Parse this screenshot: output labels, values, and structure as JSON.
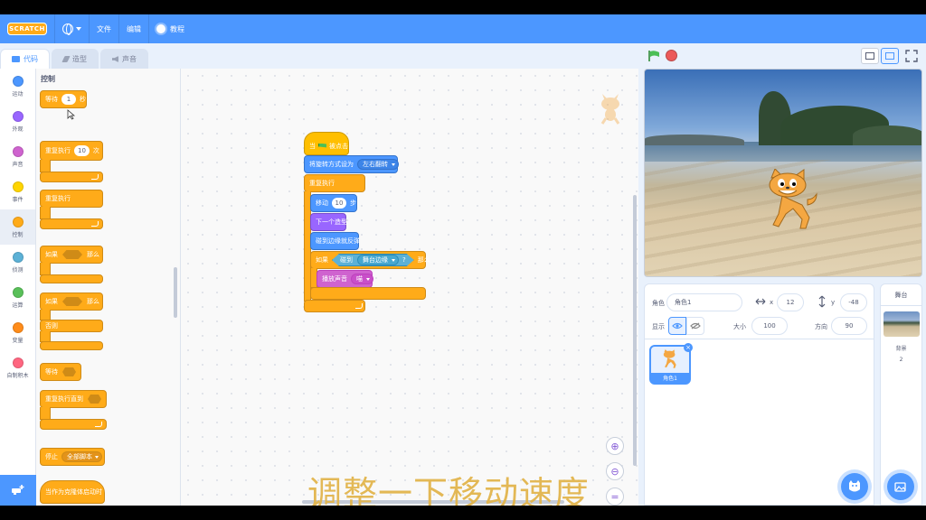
{
  "menu": {
    "logo": "SCRATCH",
    "file": "文件",
    "edit": "编辑",
    "tutorials": "教程"
  },
  "tabs": [
    {
      "label": "代码"
    },
    {
      "label": "造型"
    },
    {
      "label": "声音"
    }
  ],
  "categories": [
    {
      "label": "运动",
      "color": "#4c97ff"
    },
    {
      "label": "外观",
      "color": "#9966ff"
    },
    {
      "label": "声音",
      "color": "#cf63cf"
    },
    {
      "label": "事件",
      "color": "#ffd500"
    },
    {
      "label": "控制",
      "color": "#ffab19"
    },
    {
      "label": "侦测",
      "color": "#5cb1d6"
    },
    {
      "label": "运算",
      "color": "#59c059"
    },
    {
      "label": "变量",
      "color": "#ff8c1a"
    },
    {
      "label": "自制积木",
      "color": "#ff6680"
    }
  ],
  "palette": {
    "title": "控制",
    "wait_label": "等待",
    "wait_value": "1",
    "wait_unit": "秒",
    "repeat_label": "重复执行",
    "repeat_value": "10",
    "repeat_unit": "次",
    "forever_label": "重复执行",
    "if_label": "如果",
    "then_label": "那么",
    "if2_label": "如果",
    "then2_label": "那么",
    "else_label": "否则",
    "wait_until_label": "等待",
    "repeat_until_label": "重复执行直到",
    "stop_label": "停止",
    "stop_value": "全部脚本",
    "clone_start_label": "当作为克隆体启动时"
  },
  "script": {
    "hat_label_prefix": "当",
    "hat_label_suffix": "被点击",
    "rotation_label": "将旋转方式设为",
    "rotation_value": "左右翻转",
    "forever_label": "重复执行",
    "move_label": "移动",
    "move_value": "10",
    "move_unit": "步",
    "next_costume_label": "下一个造型",
    "bounce_label": "碰到边缘就反弹",
    "if_label": "如果",
    "touching_label": "碰到",
    "touching_value": "舞台边缘",
    "question": "?",
    "then_label": "那么",
    "play_sound_label": "播放声音",
    "play_sound_value": "喵"
  },
  "subtitle": "调整一下移动速度",
  "sprite_info": {
    "sprite_label": "角色",
    "sprite_name": "角色1",
    "x_label": "x",
    "x_value": "12",
    "y_label": "y",
    "y_value": "-48",
    "show_label": "显示",
    "size_label": "大小",
    "size_value": "100",
    "direction_label": "方向",
    "direction_value": "90"
  },
  "sprites": [
    {
      "name": "角色1"
    }
  ],
  "stage_pane": {
    "title": "舞台",
    "backdrops_label": "背景",
    "backdrops_count": "2"
  },
  "colors": {
    "accent": "#4c97ff",
    "control": "#ffab19",
    "subtitle": "#e2b54d"
  }
}
